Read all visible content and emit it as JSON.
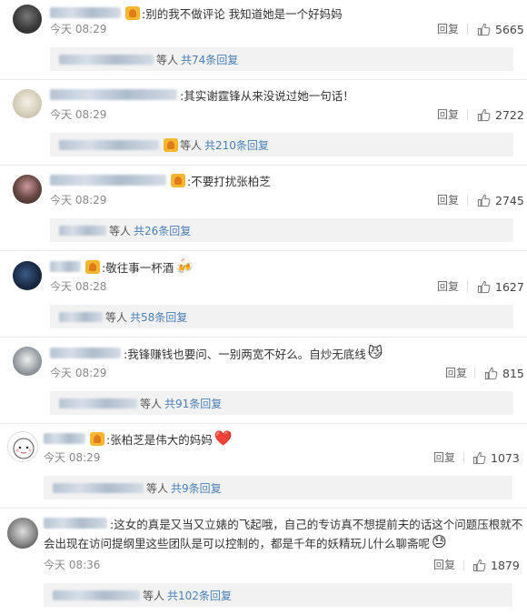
{
  "reply_label": "回复",
  "comments": [
    {
      "text": ":别的我不做评论 我知道她是一个好妈妈",
      "time": "今天 08:29",
      "likes": "5665",
      "sub_prefix": "等人",
      "sub_link": "共74条回复"
    },
    {
      "text": ":其实谢霆锋从来没说过她一句话！",
      "time": "今天 08:29",
      "likes": "2722",
      "sub_prefix": "等人",
      "sub_link": "共210条回复"
    },
    {
      "text": ":不要打扰张柏芝",
      "time": "今天 08:29",
      "likes": "2745",
      "sub_prefix": "等人",
      "sub_link": "共26条回复"
    },
    {
      "text": ":敬往事一杯酒",
      "emoji": "🍻",
      "time": "今天 08:28",
      "likes": "1627",
      "sub_prefix": "等人",
      "sub_link": "共58条回复"
    },
    {
      "text": ":我锋赚钱也要问、一别两宽不好么。自炒无底线",
      "emoji": "😼",
      "time": "今天 08:29",
      "likes": "815",
      "sub_prefix": "等人",
      "sub_link": "共91条回复"
    },
    {
      "text": ":张柏芝是伟大的妈妈",
      "emoji": "❤️",
      "time": "今天 08:29",
      "likes": "1073",
      "sub_prefix": "等人",
      "sub_link": "共9条回复"
    },
    {
      "text": ":这女的真是又当又立婊的飞起哦，自己的专访真不想提前夫的话这个问题压根就不",
      "text2": "会出现在访问提纲里这些团队是可以控制的，都是千年的妖精玩儿什么聊斋呢",
      "emoji": "😓",
      "time": "今天 08:36",
      "likes": "1879",
      "sub_prefix": "等人",
      "sub_link": "共102条回复"
    }
  ]
}
